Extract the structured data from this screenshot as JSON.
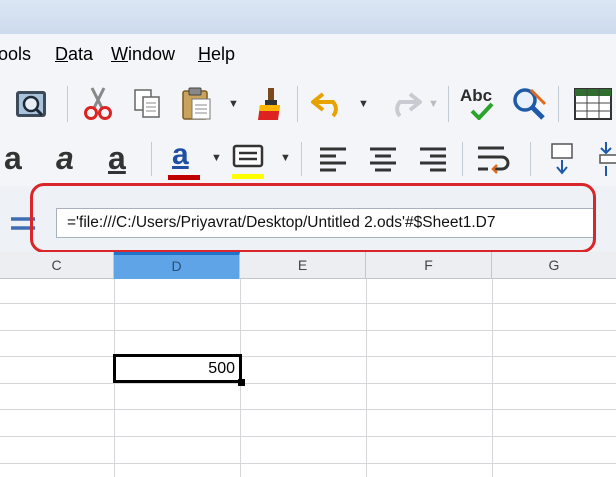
{
  "menubar": {
    "items": [
      {
        "label": "Tools",
        "shown": "ools",
        "underline": "",
        "rest": "ools"
      },
      {
        "label": "Data",
        "underline": "D",
        "rest": "ata"
      },
      {
        "label": "Window",
        "underline": "W",
        "rest": "indow"
      },
      {
        "label": "Help",
        "underline": "H",
        "rest": "elp"
      }
    ]
  },
  "toolbar1": {
    "icons": [
      "print-preview-icon",
      "cut-icon",
      "copy-icon",
      "paste-icon",
      "clone-formatting-icon",
      "undo-icon",
      "redo-icon",
      "spellcheck-icon",
      "autospellcheck-icon",
      "gridlines-icon"
    ],
    "spellcheck_text": "Abc"
  },
  "toolbar2": {
    "bold_glyph": "a",
    "italic_glyph": "a",
    "underline_glyph": "a",
    "font_color_glyph": "a",
    "font_color": "#c00000",
    "highlight_color": "#ffff00"
  },
  "formula_bar": {
    "value": "='file:///C:/Users/Priyavrat/Desktop/Untitled 2.ods'#$Sheet1.D7"
  },
  "columns": [
    "C",
    "D",
    "E",
    "F",
    "G"
  ],
  "active_column": "D",
  "active_cell": {
    "value": "500"
  },
  "colors": {
    "highlight_ring": "#d9262a",
    "active_header": "#5ea4e6",
    "accent": "#1f73c9"
  }
}
